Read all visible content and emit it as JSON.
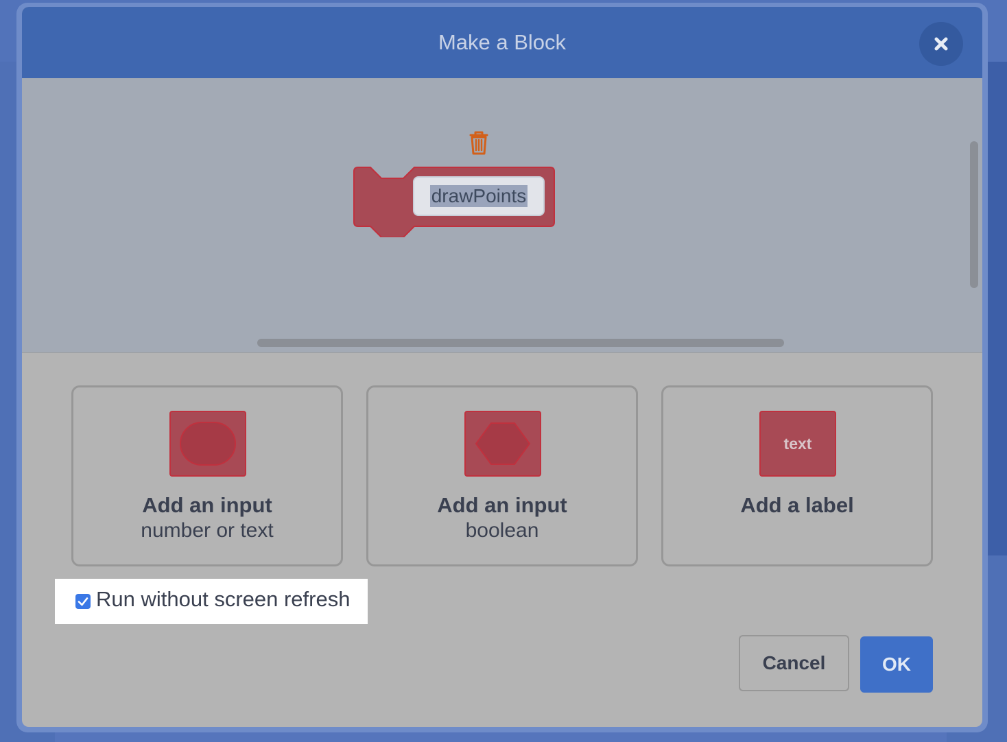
{
  "dialog": {
    "title": "Make a Block",
    "block_name": "drawPoints",
    "options": [
      {
        "icon": "round-input-icon",
        "title": "Add an input",
        "subtitle": "number or text"
      },
      {
        "icon": "hexagon-input-icon",
        "title": "Add an input",
        "subtitle": "boolean"
      },
      {
        "icon": "label-text-icon",
        "icon_text": "text",
        "title": "Add a label",
        "subtitle": ""
      }
    ],
    "run_without_refresh": {
      "label": "Run without screen refresh",
      "checked": true
    },
    "cancel_label": "Cancel",
    "ok_label": "OK"
  },
  "colors": {
    "header": "#3f67b0",
    "block_fill": "#a84a55",
    "block_border": "#c0313e",
    "ok_button": "#3f70c8",
    "trash": "#d2601a"
  }
}
